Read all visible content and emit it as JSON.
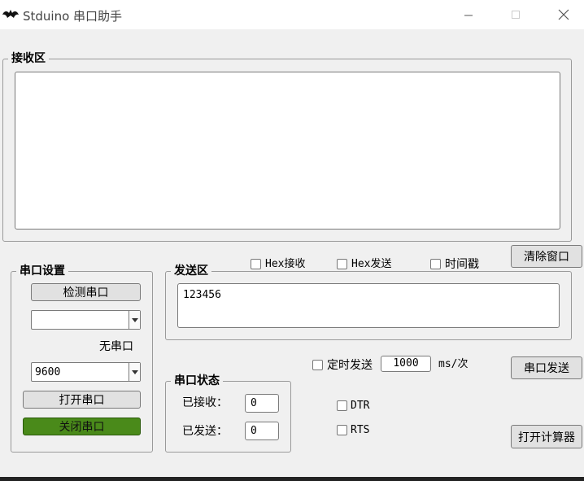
{
  "window": {
    "title": "Stduino 串口助手"
  },
  "receive": {
    "legend": "接收区",
    "content": ""
  },
  "options": {
    "hex_receive": "Hex接收",
    "hex_send": "Hex发送",
    "timestamp": "时间戳"
  },
  "buttons": {
    "clear_window": "清除窗口",
    "serial_send": "串口发送",
    "open_calculator": "打开计算器"
  },
  "serial_settings": {
    "legend": "串口设置",
    "detect_port": "检测串口",
    "port_value": "",
    "no_port": "无串口",
    "baud_value": "9600",
    "open_port": "打开串口",
    "close_port": "关闭串口"
  },
  "send": {
    "legend": "发送区",
    "content": "123456"
  },
  "timed_send": {
    "label": "定时发送",
    "interval": "1000",
    "unit": "ms/次"
  },
  "serial_status": {
    "legend": "串口状态",
    "received_label": "已接收：",
    "received_value": "0",
    "sent_label": "已发送：",
    "sent_value": "0"
  },
  "signals": {
    "dtr": "DTR",
    "rts": "RTS"
  },
  "colors": {
    "close_button": "#4a8a1a"
  }
}
